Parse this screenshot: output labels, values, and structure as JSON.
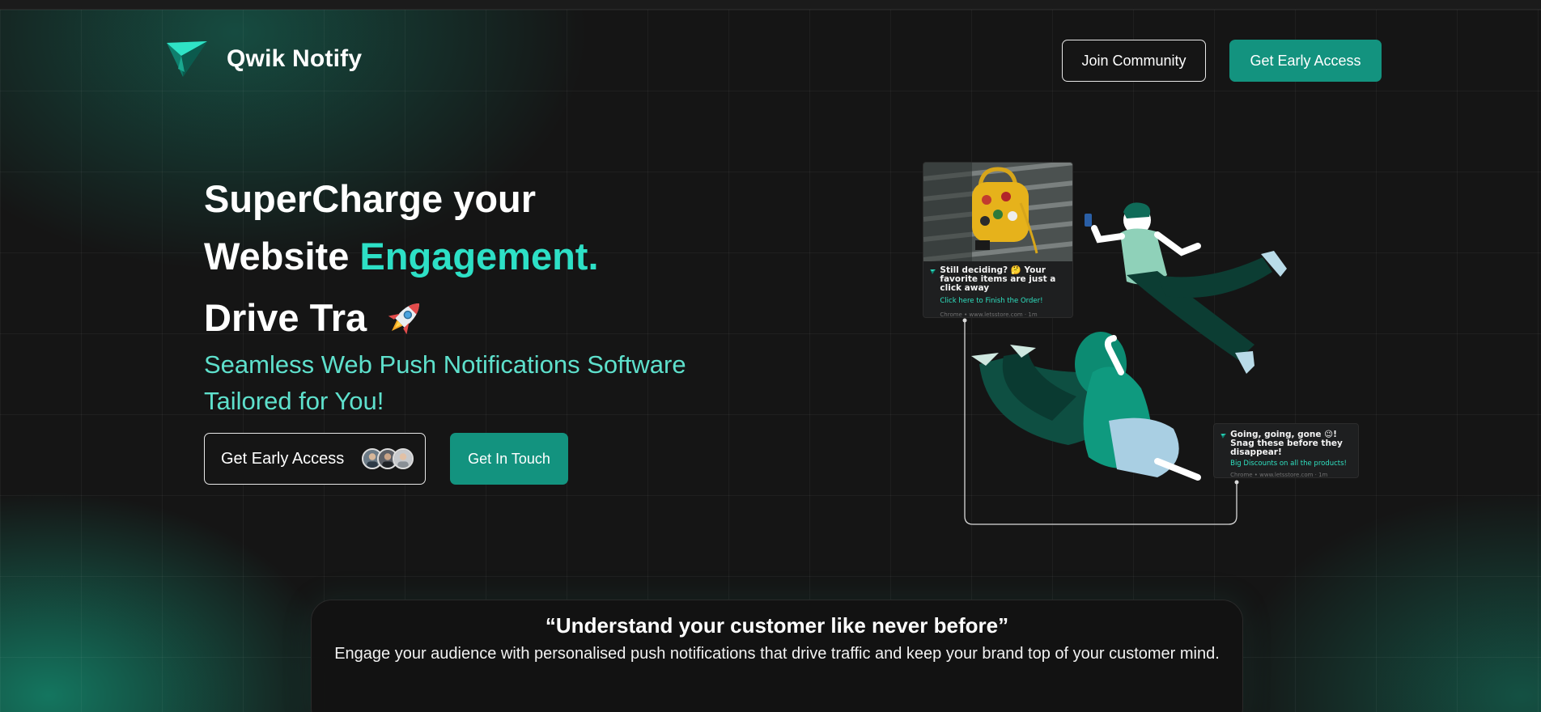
{
  "header": {
    "brand": "Qwik Notify",
    "join_label": "Join Community",
    "early_access_label": "Get Early Access"
  },
  "hero": {
    "line1": "SuperCharge your",
    "line2_prefix": "Website ",
    "line2_accent": "Engagement.",
    "line3": "Drive Tra",
    "subtitle": "Seamless Web Push Notifications Software Tailored for You!",
    "early_access_label": "Get Early Access",
    "get_in_touch_label": "Get In Touch"
  },
  "illustration": {
    "notification_1": {
      "title": "Still deciding? 🤔 Your favorite items are just a click away",
      "link": "Click here to Finish the Order!",
      "footer": "Chrome • www.letsstore.com · 1m"
    },
    "notification_2": {
      "title": "Going, going, gone 😉! Snag these before they disappear!",
      "link": "Big Discounts on all the products!",
      "footer": "Chrome • www.letsstore.com · 1m"
    }
  },
  "quote": {
    "title": "“Understand your customer like never before”",
    "text": "Engage your audience with personalised push notifications that drive traffic and keep your brand top of your customer mind."
  },
  "colors": {
    "accent": "#2de0c6",
    "subtitle": "#5ee0cc",
    "button_primary": "#13937f",
    "background": "#151515"
  },
  "icons": [
    "paper-plane-logo-icon",
    "rocket-icon",
    "avatar-icon"
  ]
}
